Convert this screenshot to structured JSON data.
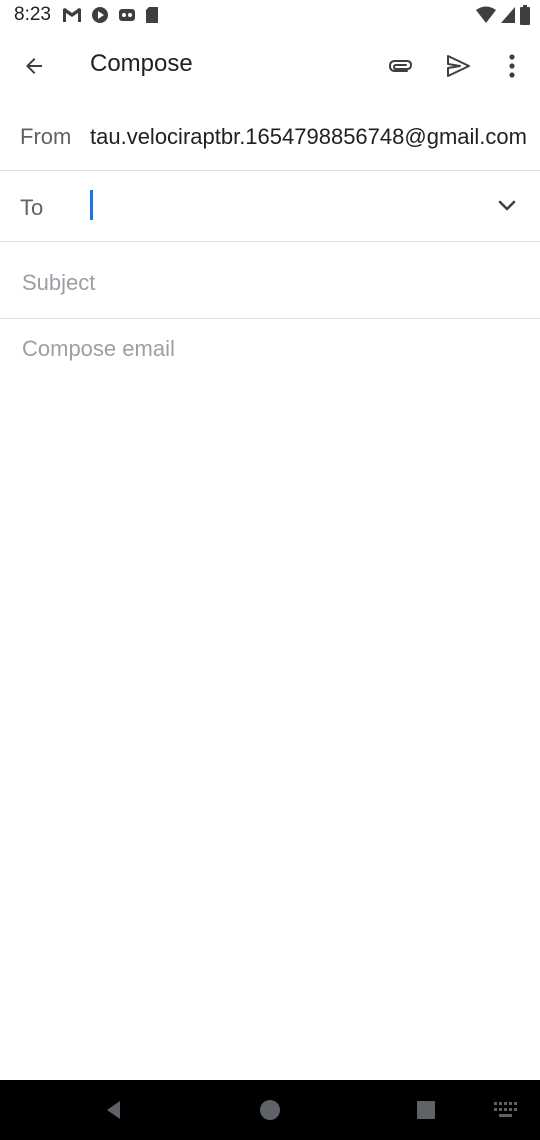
{
  "status_bar": {
    "time": "8:23",
    "left_icons": [
      "gmail-icon",
      "play-icon",
      "podcast-icon",
      "sd-card-icon"
    ],
    "right_icons": [
      "wifi-icon",
      "signal-icon",
      "battery-icon"
    ]
  },
  "app_bar": {
    "title": "Compose",
    "actions": [
      "attach-icon",
      "send-icon",
      "more-vert-icon"
    ]
  },
  "compose": {
    "from_label": "From",
    "from_value": "tau.velociraptbr.1654798856748@gmail.com",
    "to_label": "To",
    "to_value": "",
    "subject_placeholder": "Subject",
    "body_placeholder": "Compose email"
  },
  "nav_bar": {
    "buttons": [
      "back-icon",
      "home-icon",
      "recents-icon",
      "keyboard-icon"
    ]
  },
  "colors": {
    "accent": "#1a73e8",
    "text_primary": "#202124",
    "text_secondary": "#5f6368",
    "placeholder": "#9aa0a6",
    "divider": "#e0e0e0",
    "nav_bar": "#000000"
  }
}
